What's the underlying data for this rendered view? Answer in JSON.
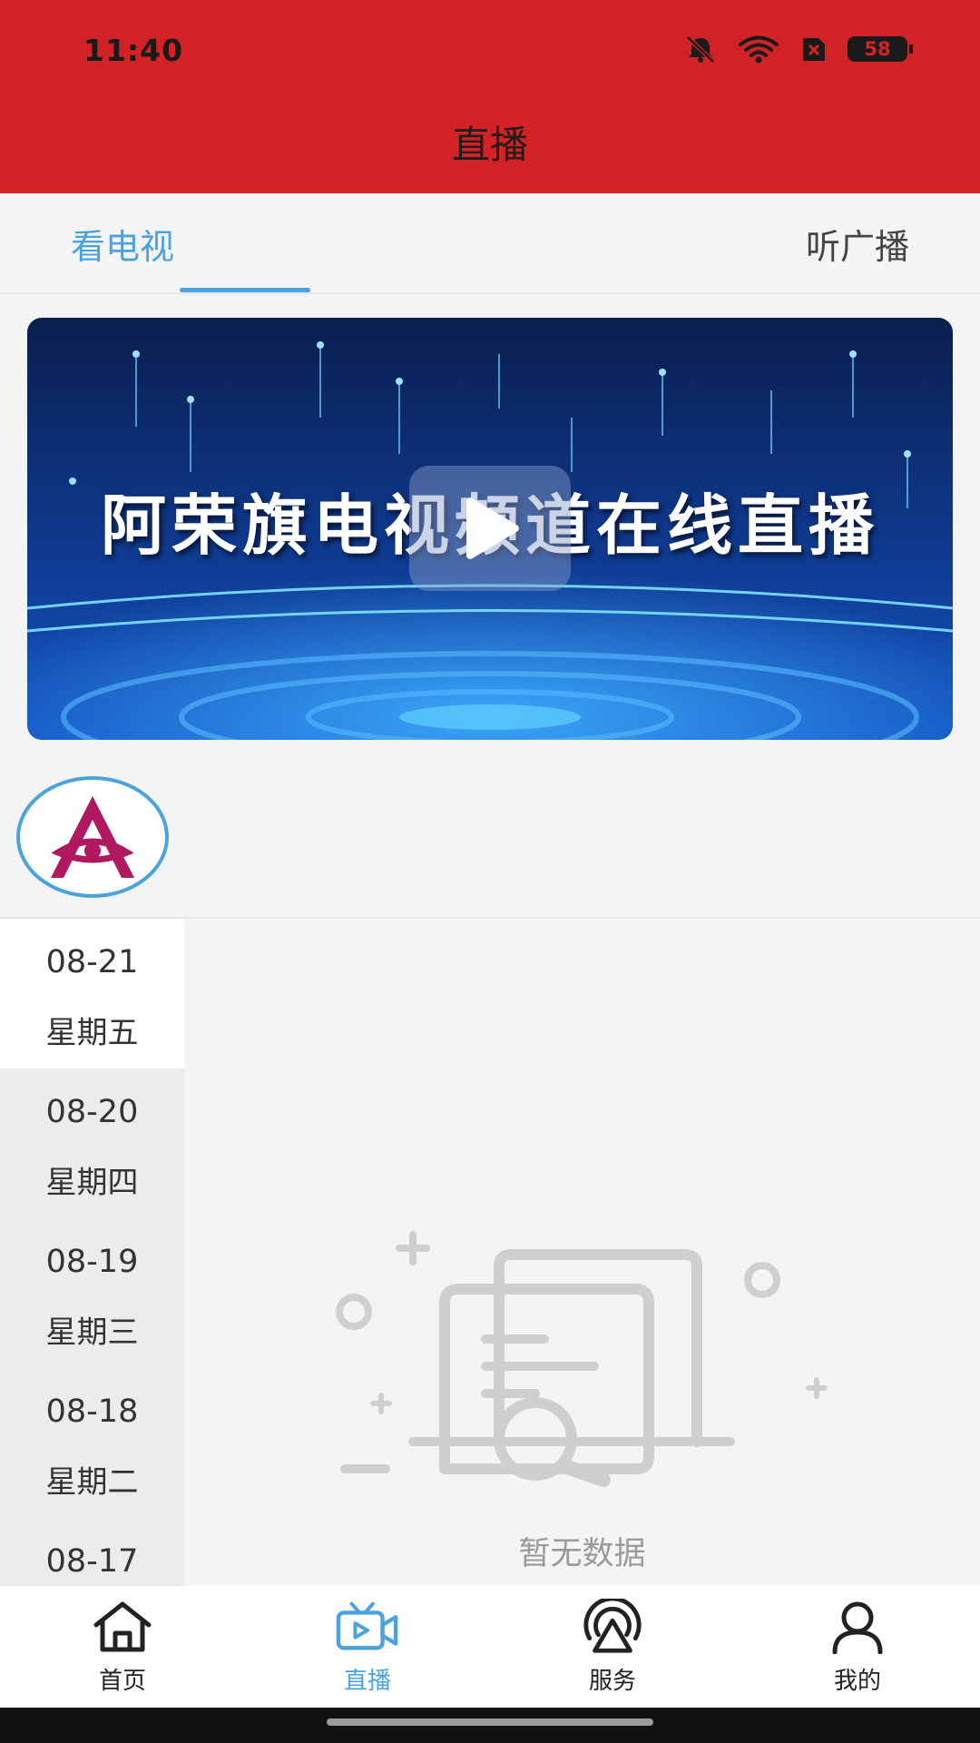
{
  "status_bar": {
    "time": "11:40",
    "battery": "58"
  },
  "header": {
    "title": "直播"
  },
  "tabs": [
    {
      "label": "看电视",
      "active": true
    },
    {
      "label": "听广播",
      "active": false
    }
  ],
  "banner": {
    "title": "阿荣旗电视频道在线直播"
  },
  "dates": [
    {
      "date": "08-21",
      "weekday": "星期五",
      "selected": true
    },
    {
      "date": "08-20",
      "weekday": "星期四"
    },
    {
      "date": "08-19",
      "weekday": "星期三"
    },
    {
      "date": "08-18",
      "weekday": "星期二"
    },
    {
      "date": "08-17",
      "weekday": ""
    }
  ],
  "empty_state": {
    "text": "暂无数据"
  },
  "bottom_nav": [
    {
      "label": "首页",
      "icon": "home-icon"
    },
    {
      "label": "直播",
      "icon": "tv-camera-icon",
      "active": true
    },
    {
      "label": "服务",
      "icon": "service-icon"
    },
    {
      "label": "我的",
      "icon": "user-icon"
    }
  ],
  "colors": {
    "header_red": "#d32226",
    "accent_blue": "#4aa3df",
    "logo_magenta": "#b0185f"
  }
}
